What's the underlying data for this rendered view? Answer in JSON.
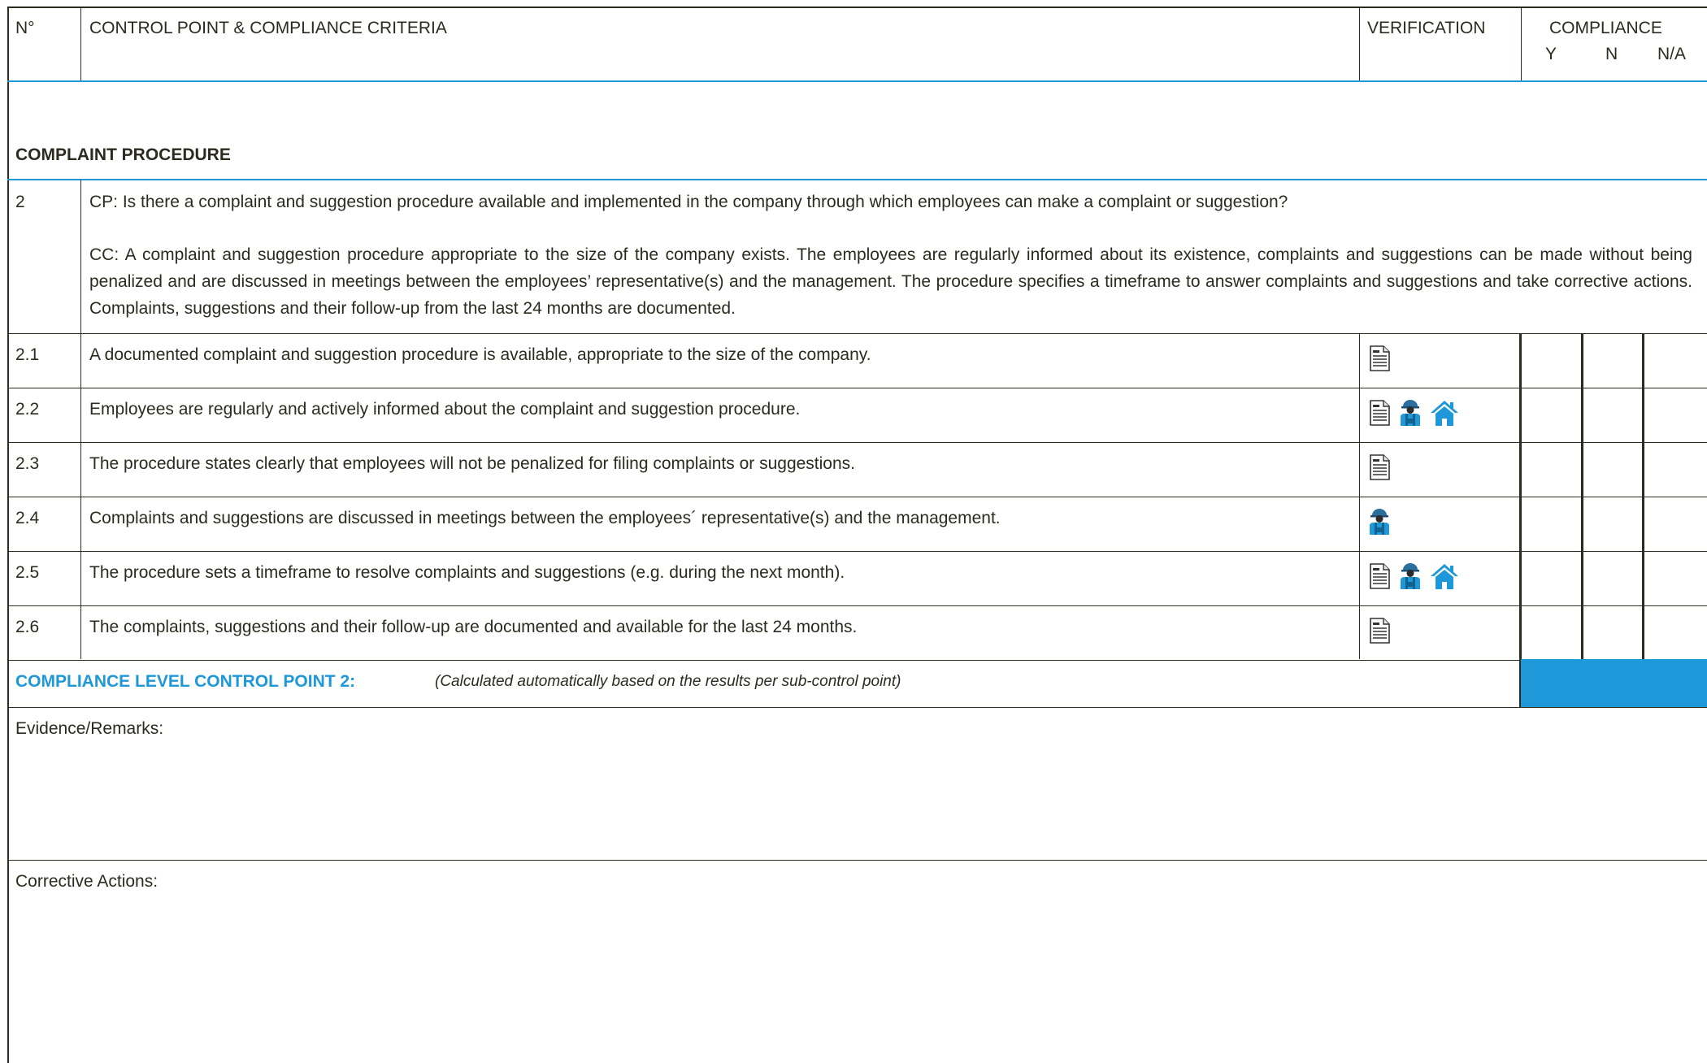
{
  "header": {
    "no_label": "N°",
    "control_point_label": "CONTROL POINT & COMPLIANCE CRITERIA",
    "verification_label": "VERIFICATION",
    "compliance_label": "COMPLIANCE",
    "compliance_y": "Y",
    "compliance_n": "N",
    "compliance_na": "N/A"
  },
  "section": {
    "title": "COMPLAINT PROCEDURE"
  },
  "control_point": {
    "number": "2",
    "cp_text": "CP: Is there a complaint and suggestion procedure available and implemented in the company through which employees can make a complaint or suggestion?",
    "cc_text": "CC: A complaint and suggestion procedure appropriate to the size of the company exists. The employees are regularly informed about its existence, complaints and suggestions can be made without being penalized and are discussed in meetings between the employees’ representative(s) and the management. The procedure specifies a timeframe to answer complaints and suggestions and take corrective actions. Complaints, suggestions and their follow-up from the last 24 months are documented."
  },
  "rows": [
    {
      "number": "2.1",
      "text": "A documented complaint and suggestion procedure is available, appropriate to the size of the company.",
      "verification": [
        "document-icon"
      ]
    },
    {
      "number": "2.2",
      "text": "Employees are regularly and actively informed about the complaint and suggestion procedure.",
      "verification": [
        "document-icon",
        "worker-icon",
        "house-icon"
      ]
    },
    {
      "number": "2.3",
      "text": "The procedure states clearly that employees will not be penalized for filing complaints or suggestions.",
      "verification": [
        "document-icon"
      ]
    },
    {
      "number": "2.4",
      "text": "Complaints and suggestions are discussed in meetings between the employees´ representative(s) and the management.",
      "verification": [
        "worker-icon"
      ]
    },
    {
      "number": "2.5",
      "text": "The procedure sets a timeframe to resolve complaints and suggestions (e.g. during the next month).",
      "verification": [
        "document-icon",
        "worker-icon",
        "house-icon"
      ]
    },
    {
      "number": "2.6",
      "text": "The complaints, suggestions and their follow-up are documented and available for the last 24 months.",
      "verification": [
        "document-icon"
      ]
    }
  ],
  "compliance_level": {
    "label": "COMPLIANCE LEVEL CONTROL POINT 2:",
    "note": "(Calculated automatically based on the results per sub-control point)"
  },
  "evidence": {
    "label": "Evidence/Remarks:"
  },
  "corrective": {
    "label": "Corrective Actions:"
  },
  "colors": {
    "accent_blue": "#1e98d8",
    "text": "#2b2b1f",
    "border": "#2b2b1f"
  }
}
